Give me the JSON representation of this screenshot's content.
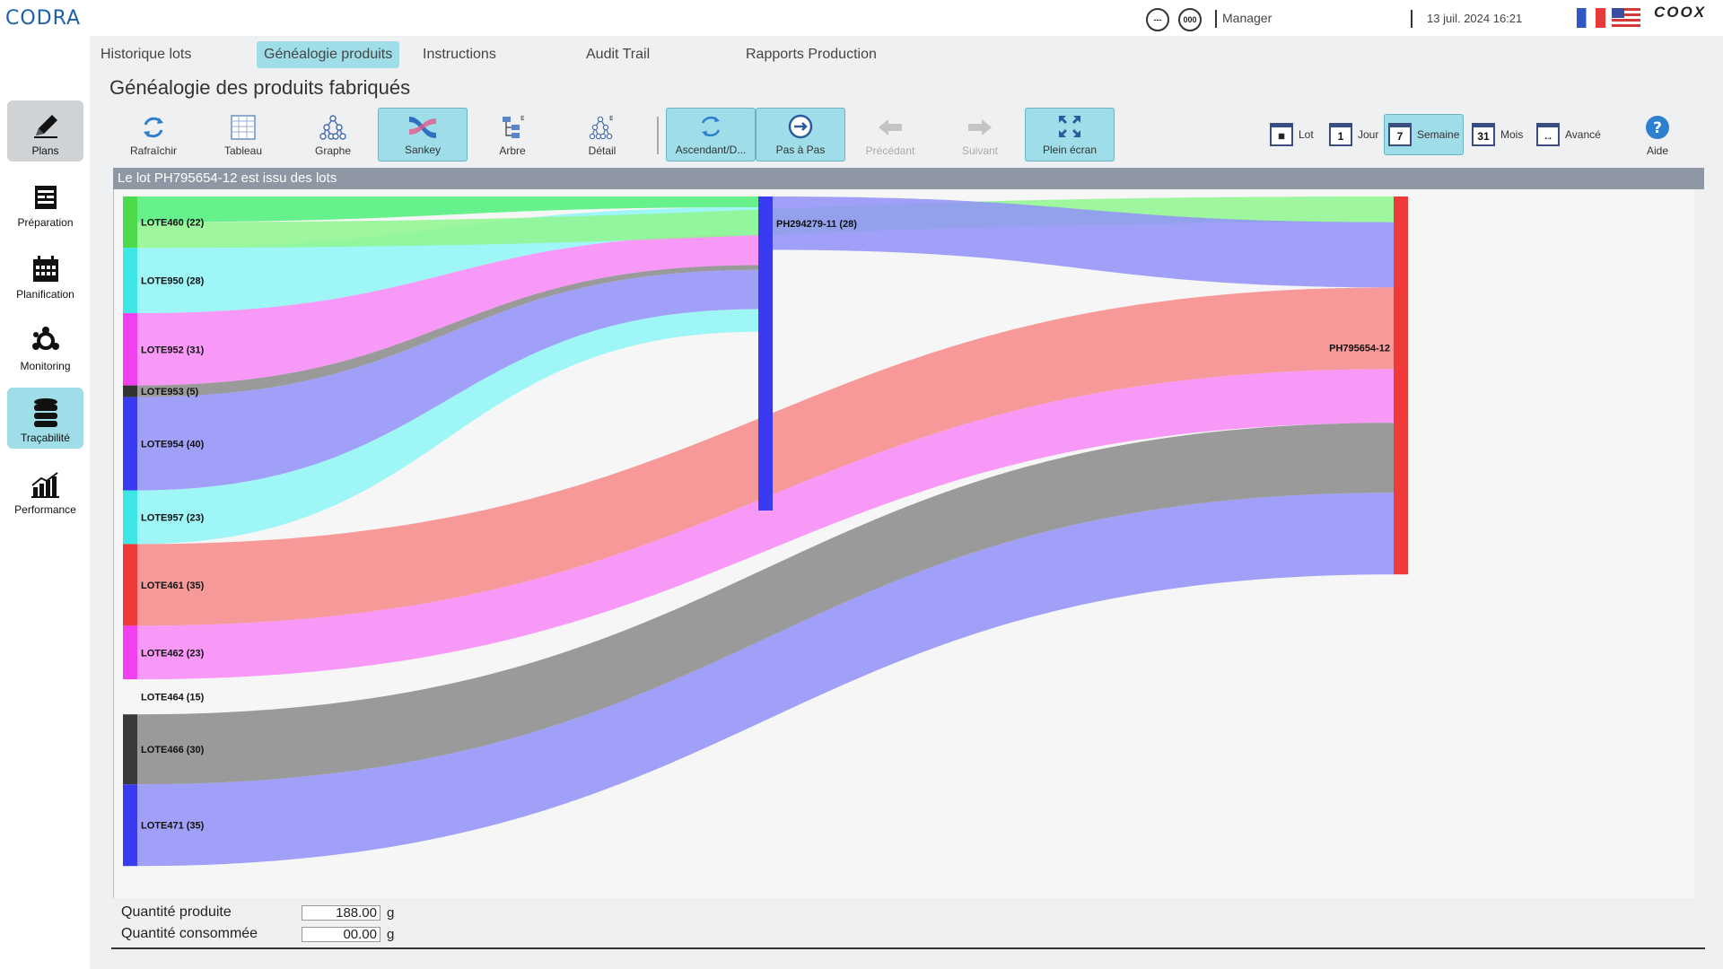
{
  "header": {
    "logo": "CODRA",
    "status_icon_1": "---",
    "status_icon_2": "000",
    "user": "Manager",
    "datetime": "13 juil. 2024 16:21",
    "brand": "COOX"
  },
  "sidebar": {
    "items": [
      {
        "label": "Plans",
        "icon": "pencil-icon"
      },
      {
        "label": "Préparation",
        "icon": "clipboard-icon"
      },
      {
        "label": "Planification",
        "icon": "calendar-icon"
      },
      {
        "label": "Monitoring",
        "icon": "network-icon"
      },
      {
        "label": "Traçabilité",
        "icon": "database-icon"
      },
      {
        "label": "Performance",
        "icon": "bar-chart-icon"
      }
    ]
  },
  "tabs": [
    {
      "label": "Historique lots"
    },
    {
      "label": "Généalogie produits"
    },
    {
      "label": "Instructions"
    },
    {
      "label": "Audit Trail"
    },
    {
      "label": "Rapports Production"
    }
  ],
  "page": {
    "title": "Généalogie des produits fabriqués"
  },
  "toolbar": {
    "refresh": "Rafraîchir",
    "table": "Tableau",
    "graph": "Graphe",
    "sankey": "Sankey",
    "tree": "Arbre",
    "detail": "Détail",
    "ascending": "Ascendant/D...",
    "step": "Pas à Pas",
    "previous": "Précédant",
    "next": "Suivant",
    "fullscreen": "Plein écran",
    "help": "Aide"
  },
  "period": {
    "lot": "Lot",
    "day": "Jour",
    "day_num": "1",
    "week": "Semaine",
    "week_num": "7",
    "month": "Mois",
    "month_num": "31",
    "advanced": "Avancé"
  },
  "panel": {
    "header": "Le lot  PH795654-12 est issu des lots"
  },
  "quantities": {
    "produced_label": "Quantité produite",
    "produced_value": "188.00",
    "consumed_label": "Quantité consommée",
    "consumed_value": "00.00",
    "unit": "g"
  },
  "chart_data": {
    "type": "sankey",
    "nodes": [
      {
        "id": "LOTE460",
        "label": "LOTE460 (22)",
        "value": 22,
        "color": "#4cd94c"
      },
      {
        "id": "LOTE950",
        "label": "LOTE950 (28)",
        "value": 28,
        "color": "#3fe6e6"
      },
      {
        "id": "LOTE952",
        "label": "LOTE952 (31)",
        "value": 31,
        "color": "#f040f0"
      },
      {
        "id": "LOTE953",
        "label": "LOTE953 (5)",
        "value": 5,
        "color": "#333333"
      },
      {
        "id": "LOTE954",
        "label": "LOTE954 (40)",
        "value": 40,
        "color": "#3a3af0"
      },
      {
        "id": "LOTE957",
        "label": "LOTE957 (23)",
        "value": 23,
        "color": "#3fe6e6"
      },
      {
        "id": "LOTE461",
        "label": "LOTE461 (35)",
        "value": 35,
        "color": "#f03a3a"
      },
      {
        "id": "LOTE462",
        "label": "LOTE462 (23)",
        "value": 23,
        "color": "#f040f0"
      },
      {
        "id": "LOTE464",
        "label": "LOTE464 (15)",
        "value": 15,
        "color": "#f6f6f6"
      },
      {
        "id": "LOTE466",
        "label": "LOTE466 (30)",
        "value": 30,
        "color": "#3a3a3a"
      },
      {
        "id": "LOTE471",
        "label": "LOTE471 (35)",
        "value": 35,
        "color": "#3a3af0"
      },
      {
        "id": "PH294279-11",
        "label": "PH294279-11 (28)",
        "value": 28,
        "color": "#3a3af0"
      },
      {
        "id": "PH795654-12",
        "label": "PH795654-12",
        "value": 188,
        "color": "#f03a3a"
      }
    ],
    "links": [
      {
        "source": "LOTE460",
        "target": "PH294279-11",
        "color": "#4cf07a"
      },
      {
        "source": "LOTE950",
        "target": "PH294279-11",
        "color": "#8ef6f6"
      },
      {
        "source": "LOTE952",
        "target": "PH294279-11",
        "color": "#f888f8"
      },
      {
        "source": "LOTE953",
        "target": "PH294279-11",
        "color": "#8a8a8a"
      },
      {
        "source": "LOTE954",
        "target": "PH294279-11",
        "color": "#9090f8"
      },
      {
        "source": "LOTE957",
        "target": "PH294279-11",
        "color": "#8ef6f6"
      },
      {
        "source": "LOTE460",
        "target": "PH795654-12",
        "color": "#8ef68e"
      },
      {
        "source": "PH294279-11",
        "target": "PH795654-12",
        "color": "#9090f8"
      },
      {
        "source": "LOTE461",
        "target": "PH795654-12",
        "color": "#f88888"
      },
      {
        "source": "LOTE462",
        "target": "PH795654-12",
        "color": "#f888f8"
      },
      {
        "source": "LOTE466",
        "target": "PH795654-12",
        "color": "#8a8a8a"
      },
      {
        "source": "LOTE471",
        "target": "PH795654-12",
        "color": "#9090f8"
      }
    ]
  }
}
